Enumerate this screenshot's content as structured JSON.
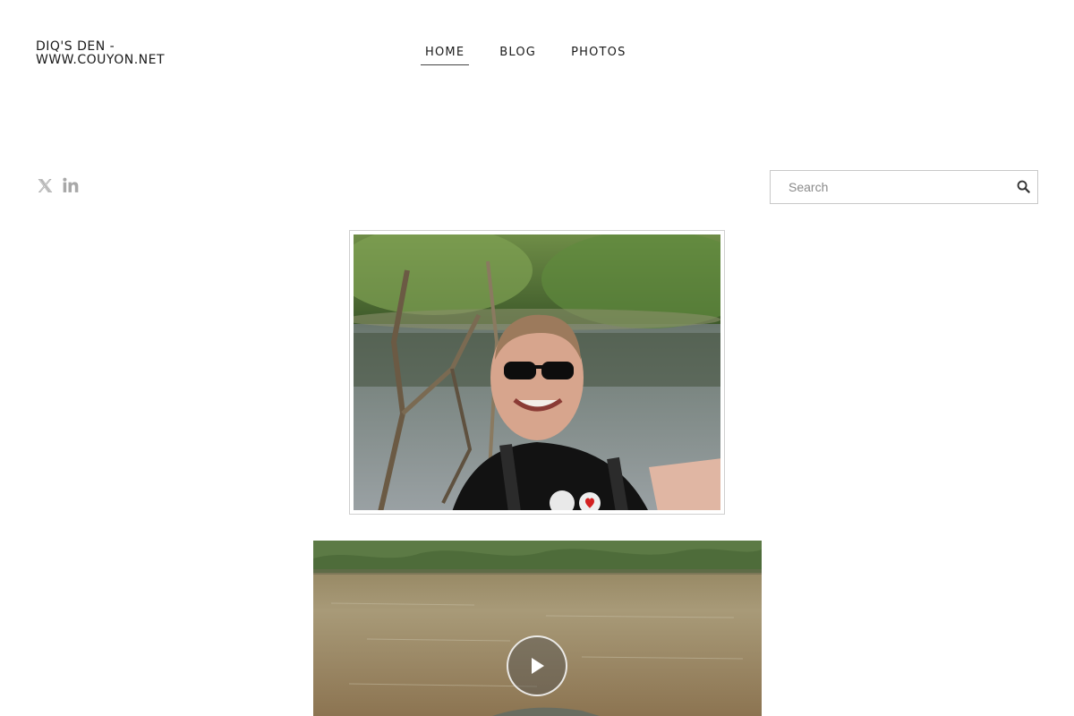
{
  "site": {
    "title_line1": "DIQ'S DEN -",
    "title_line2": "WWW.COUYON.NET"
  },
  "nav": {
    "items": [
      {
        "label": "HOME",
        "active": true
      },
      {
        "label": "BLOG",
        "active": false
      },
      {
        "label": "PHOTOS",
        "active": false
      }
    ]
  },
  "social": {
    "icons": [
      "x-twitter-icon",
      "linkedin-icon"
    ],
    "icon_color": "#a8a8a8"
  },
  "search": {
    "placeholder": "Search",
    "value": ""
  },
  "media": {
    "photo_alt": "selfie-in-front-of-pond",
    "video_has_play_button": true
  },
  "colors": {
    "text": "#1a1a1a",
    "border": "#c8c8c8",
    "background": "#ffffff"
  }
}
